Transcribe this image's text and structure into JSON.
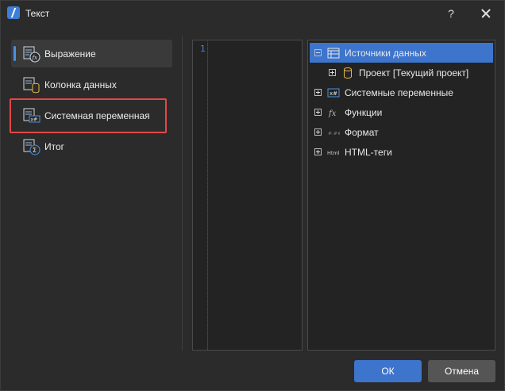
{
  "window": {
    "title": "Текст",
    "help_label": "?"
  },
  "nav": {
    "items": [
      {
        "label": "Выражение",
        "icon": "expression-icon",
        "selected": true
      },
      {
        "label": "Колонка данных",
        "icon": "data-column-icon",
        "selected": false
      },
      {
        "label": "Системная переменная",
        "icon": "system-variable-icon",
        "selected": false,
        "highlighted": true
      },
      {
        "label": "Итог",
        "icon": "total-icon",
        "selected": false
      }
    ]
  },
  "editor": {
    "line_number": "1",
    "content": ""
  },
  "tree": {
    "items": [
      {
        "label": "Источники данных",
        "icon": "datasource-icon",
        "expander": "minus",
        "level": 0,
        "selected": true
      },
      {
        "label": "Проект [Текущий проект]",
        "icon": "database-icon",
        "expander": "plus",
        "level": 1,
        "selected": false
      },
      {
        "label": "Системные переменные",
        "icon": "system-variable-icon",
        "expander": "plus",
        "level": 0,
        "selected": false
      },
      {
        "label": "Функции",
        "icon": "function-icon",
        "expander": "plus",
        "level": 0,
        "selected": false
      },
      {
        "label": "Формат",
        "icon": "format-icon",
        "expander": "plus",
        "level": 0,
        "selected": false
      },
      {
        "label": "HTML-теги",
        "icon": "html-icon",
        "expander": "plus",
        "level": 0,
        "selected": false
      }
    ]
  },
  "buttons": {
    "ok_label": "ОК",
    "cancel_label": "Отмена"
  },
  "colors": {
    "accent": "#3d74cc",
    "highlight": "#e04848",
    "background": "#2b2b2b"
  }
}
